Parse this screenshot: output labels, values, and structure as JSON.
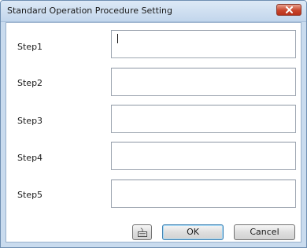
{
  "window": {
    "title": "Standard Operation Procedure Setting"
  },
  "steps": [
    {
      "label": "Step1",
      "value": ""
    },
    {
      "label": "Step2",
      "value": ""
    },
    {
      "label": "Step3",
      "value": ""
    },
    {
      "label": "Step4",
      "value": ""
    },
    {
      "label": "Step5",
      "value": ""
    }
  ],
  "buttons": {
    "keyboard_icon": "keyboard-icon",
    "ok_label": "OK",
    "cancel_label": "Cancel"
  },
  "colors": {
    "titlebar": "#c9dbee",
    "close_button": "#c8452c",
    "ok_border": "#3c7fb1"
  }
}
